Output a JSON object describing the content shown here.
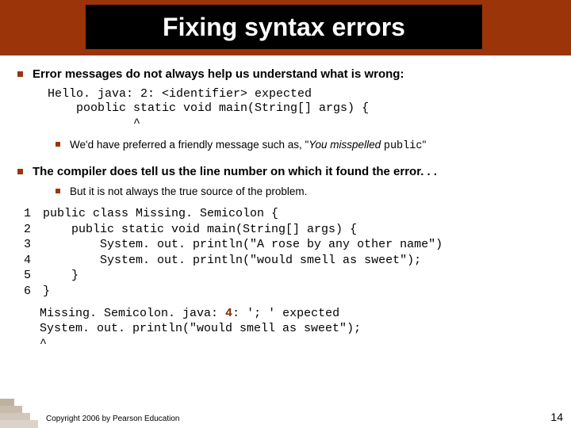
{
  "title": "Fixing syntax errors",
  "bullets": {
    "b1": "Error messages do not always help us understand what is wrong:",
    "code1": "Hello. java: 2: <identifier> expected\n    pooblic static void main(String[] args) {\n            ^",
    "b1sub_pre": "We'd have preferred a friendly message such as, \"",
    "b1sub_italic": "You misspelled ",
    "b1sub_mono": "public",
    "b1sub_post": "\"",
    "b2": "The compiler does tell us the line number on which it found the error. . .",
    "b2sub": "But it is not always the true source of the problem."
  },
  "numbered": [
    {
      "n": "1",
      "c": "public class Missing. Semicolon {"
    },
    {
      "n": "2",
      "c": "    public static void main(String[] args) {"
    },
    {
      "n": "3",
      "c": "        System. out. println(\"A rose by any other name\")"
    },
    {
      "n": "4",
      "c": "        System. out. println(\"would smell as sweet\");"
    },
    {
      "n": "5",
      "c": "    }"
    },
    {
      "n": "6",
      "c": "}"
    }
  ],
  "err": {
    "line1a": "Missing. Semicolon. java:",
    "line1b": " 4",
    "line1c": ": '; ' expected",
    "line2": "System. out. println(\"would smell as sweet\");",
    "line3": "^"
  },
  "footer": {
    "copyright": "Copyright 2006 by Pearson Education",
    "page": "14"
  }
}
